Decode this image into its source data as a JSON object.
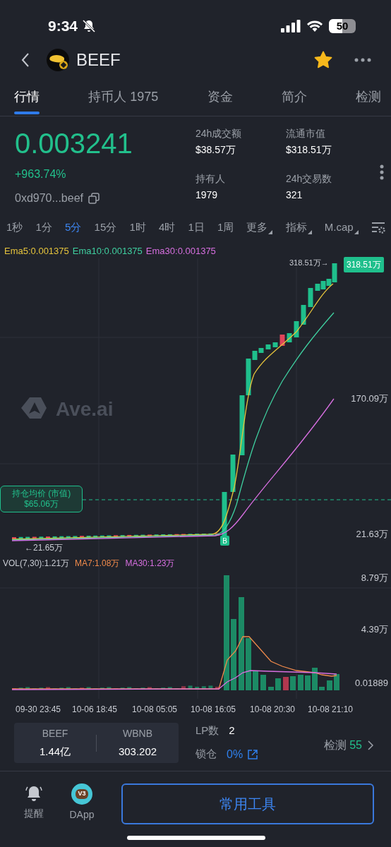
{
  "status_bar": {
    "time": "9:34",
    "battery": "50"
  },
  "header": {
    "title": "BEEF",
    "favorite": true
  },
  "tabs": [
    {
      "label": "行情",
      "selected": true
    },
    {
      "label": "持币人 1975",
      "selected": false
    },
    {
      "label": "资金",
      "selected": false
    },
    {
      "label": "简介",
      "selected": false
    },
    {
      "label": "检测",
      "selected": false
    }
  ],
  "price": {
    "value": "0.003241",
    "change": "+963.74%",
    "address": "0xd970...beef"
  },
  "stats": [
    {
      "label": "24h成交额",
      "value": "$38.57万"
    },
    {
      "label": "流通市值",
      "value": "$318.51万"
    },
    {
      "label": "持有人",
      "value": "1979"
    },
    {
      "label": "24h交易数",
      "value": "321"
    }
  ],
  "intervals": [
    {
      "label": "1秒",
      "selected": false,
      "dropdown": false
    },
    {
      "label": "1分",
      "selected": false,
      "dropdown": false
    },
    {
      "label": "5分",
      "selected": true,
      "dropdown": false
    },
    {
      "label": "15分",
      "selected": false,
      "dropdown": false
    },
    {
      "label": "1时",
      "selected": false,
      "dropdown": false
    },
    {
      "label": "4时",
      "selected": false,
      "dropdown": false
    },
    {
      "label": "1日",
      "selected": false,
      "dropdown": false
    },
    {
      "label": "1周",
      "selected": false,
      "dropdown": false
    },
    {
      "label": "更多",
      "selected": false,
      "dropdown": true
    },
    {
      "label": "指标",
      "selected": false,
      "dropdown": true
    },
    {
      "label": "M.cap",
      "selected": false,
      "dropdown": true
    }
  ],
  "chart": {
    "legend": [
      {
        "label": "Ema5:0.001375",
        "color": "#e6c43c"
      },
      {
        "label": "Ema10:0.001375",
        "color": "#3fd0a0"
      },
      {
        "label": "Ema30:0.001375",
        "color": "#d76fe0"
      }
    ],
    "watermark": "Ave.ai",
    "last_price_label": "318.51万→",
    "last_price_tag": "318.51万",
    "y_labels": [
      "170.09万",
      "21.63万"
    ],
    "position_label": "持仓均价 (市值)",
    "position_value": "$65.06万",
    "low_label": "←21.65万",
    "buy_marker": "B"
  },
  "volume": {
    "legend": [
      {
        "label": "VOL(7,30):1.21万",
        "color": "#c9ccd3"
      },
      {
        "label": "MA7:1.08万",
        "color": "#f08a4b"
      },
      {
        "label": "MA30:1.23万",
        "color": "#d76fe0"
      }
    ],
    "y_labels": [
      "8.79万",
      "4.39万",
      "0.01889"
    ]
  },
  "time_axis": [
    "09-30 23:45",
    "10-06 18:45",
    "10-08 05:05",
    "10-08 16:05",
    "10-08 20:30",
    "10-08 21:10"
  ],
  "pool": {
    "tokens": [
      {
        "symbol": "BEEF",
        "amount": "1.44亿"
      },
      {
        "symbol": "WBNB",
        "amount": "303.202"
      }
    ],
    "lp_label": "LP数",
    "lp_count": "2",
    "lock_label": "锁仓",
    "lock_value": "0%",
    "check_label": "检测",
    "check_score": "55"
  },
  "bottom_bar": {
    "items": [
      {
        "kind": "bell",
        "label": "提醒"
      },
      {
        "kind": "dapp",
        "label": "DApp",
        "badge": "V3"
      }
    ],
    "button": "常用工具"
  }
}
